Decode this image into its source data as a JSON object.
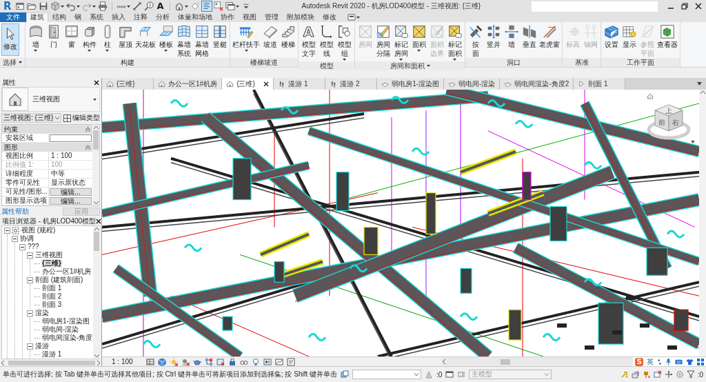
{
  "title_bar": {
    "logo": "R",
    "quick_access": [
      {
        "dropdown": false,
        "active": false
      },
      {
        "dropdown": false,
        "active": false
      },
      {
        "dropdown": false,
        "active": false
      },
      {
        "dropdown": true,
        "active": false
      },
      {
        "dropdown": true,
        "active": false
      },
      {
        "dropdown": true,
        "active": false
      },
      {
        "dropdown": false,
        "active": false
      },
      {
        "dropdown": true,
        "active": false
      },
      {
        "dropdown": false,
        "active": false
      },
      {
        "dropdown": false,
        "active": false
      },
      {
        "glyph": "A",
        "dropdown": false,
        "active": false
      },
      {
        "dropdown": true,
        "active": false
      },
      {
        "dropdown": false,
        "active": false
      },
      {
        "dropdown": false,
        "active": true
      },
      {
        "dropdown": false,
        "active": false
      },
      {
        "dropdown": true,
        "active": false
      },
      {
        "dropdown": false,
        "active": false
      }
    ],
    "title": "Autodesk Revit 2020 - 机房LOD400模型 - 三维视图: {三维}"
  },
  "ribbon_tabs": [
    {
      "label": "文件",
      "kind": "menu",
      "selected": false
    },
    {
      "label": "建筑",
      "kind": "tab",
      "selected": true
    },
    {
      "label": "结构",
      "kind": "tab",
      "selected": false
    },
    {
      "label": "钢",
      "kind": "tab",
      "selected": false
    },
    {
      "label": "系统",
      "kind": "tab",
      "selected": false
    },
    {
      "label": "插入",
      "kind": "tab",
      "selected": false
    },
    {
      "label": "注释",
      "kind": "tab",
      "selected": false
    },
    {
      "label": "分析",
      "kind": "tab",
      "selected": false
    },
    {
      "label": "体量和场地",
      "kind": "tab",
      "selected": false
    },
    {
      "label": "协作",
      "kind": "tab",
      "selected": false
    },
    {
      "label": "视图",
      "kind": "tab",
      "selected": false
    },
    {
      "label": "管理",
      "kind": "tab",
      "selected": false
    },
    {
      "label": "附加模块",
      "kind": "tab",
      "selected": false
    },
    {
      "label": "修改",
      "kind": "tab",
      "selected": false
    }
  ],
  "ribbon": {
    "panels": [
      {
        "title": "选择",
        "menu": true,
        "buttons": [
          {
            "lines": [
              "修改"
            ],
            "dropdown": false,
            "disabled": false,
            "active": true
          }
        ]
      },
      {
        "title": "构建",
        "menu": false,
        "buttons": [
          {
            "lines": [
              "墙"
            ],
            "dropdown": true,
            "disabled": false,
            "active": false
          },
          {
            "lines": [
              "门"
            ],
            "dropdown": false,
            "disabled": false,
            "active": false
          },
          {
            "lines": [
              "窗"
            ],
            "dropdown": false,
            "disabled": false,
            "active": false
          },
          {
            "lines": [
              "构件"
            ],
            "dropdown": true,
            "disabled": false,
            "active": false
          },
          {
            "lines": [
              "柱"
            ],
            "dropdown": true,
            "disabled": false,
            "active": false
          },
          {
            "lines": [
              "屋顶"
            ],
            "dropdown": false,
            "disabled": false,
            "active": false
          },
          {
            "lines": [
              "天花板"
            ],
            "dropdown": false,
            "disabled": false,
            "active": false
          },
          {
            "lines": [
              "楼板"
            ],
            "dropdown": true,
            "disabled": false,
            "active": false
          },
          {
            "lines": [
              "幕墙",
              "系统"
            ],
            "dropdown": false,
            "disabled": false,
            "active": false
          },
          {
            "lines": [
              "幕墙",
              "网格"
            ],
            "dropdown": false,
            "disabled": false,
            "active": false
          },
          {
            "lines": [
              "竖梃"
            ],
            "dropdown": false,
            "disabled": false,
            "active": false
          }
        ]
      },
      {
        "title": "楼梯坡道",
        "menu": false,
        "buttons": [
          {
            "lines": [
              "栏杆扶手"
            ],
            "dropdown": true,
            "disabled": false,
            "active": false
          },
          {
            "lines": [
              "坡道"
            ],
            "dropdown": false,
            "disabled": false,
            "active": false
          },
          {
            "lines": [
              "楼梯"
            ],
            "dropdown": false,
            "disabled": false,
            "active": false
          }
        ]
      },
      {
        "title": "模型",
        "menu": false,
        "buttons": [
          {
            "lines": [
              "模型",
              "文字"
            ],
            "glyph": "A",
            "dropdown": false,
            "disabled": false,
            "active": false
          },
          {
            "lines": [
              "模型",
              "线"
            ],
            "dropdown": false,
            "disabled": false,
            "active": false
          },
          {
            "lines": [
              "模型",
              "组"
            ],
            "dropdown": true,
            "disabled": false,
            "active": false
          }
        ]
      },
      {
        "title": "房间和面积",
        "menu": true,
        "buttons": [
          {
            "lines": [
              "房间"
            ],
            "dropdown": false,
            "disabled": true,
            "active": false
          },
          {
            "lines": [
              "房间",
              "分隔"
            ],
            "dropdown": false,
            "disabled": false,
            "active": false
          },
          {
            "lines": [
              "标记",
              "房间"
            ],
            "dropdown": true,
            "disabled": false,
            "active": false
          },
          {
            "lines": [
              "面积"
            ],
            "dropdown": true,
            "disabled": false,
            "active": false
          },
          {
            "lines": [
              "面积",
              "边界"
            ],
            "dropdown": false,
            "disabled": true,
            "active": false
          },
          {
            "lines": [
              "标记",
              "面积"
            ],
            "dropdown": true,
            "disabled": false,
            "active": false
          }
        ]
      },
      {
        "title": "洞口",
        "menu": false,
        "buttons": [
          {
            "lines": [
              "按",
              "面"
            ],
            "dropdown": false,
            "disabled": false,
            "active": false
          },
          {
            "lines": [
              "竖井"
            ],
            "dropdown": false,
            "disabled": false,
            "active": false
          },
          {
            "lines": [
              "墙"
            ],
            "dropdown": false,
            "disabled": false,
            "active": false
          },
          {
            "lines": [
              "垂直"
            ],
            "dropdown": false,
            "disabled": false,
            "active": false
          },
          {
            "lines": [
              "老虎窗"
            ],
            "dropdown": false,
            "disabled": false,
            "active": false
          }
        ]
      },
      {
        "title": "基准",
        "menu": false,
        "buttons": [
          {
            "lines": [
              "标高"
            ],
            "dropdown": false,
            "disabled": true,
            "active": false
          },
          {
            "lines": [
              "轴网"
            ],
            "dropdown": false,
            "disabled": true,
            "active": false
          }
        ]
      },
      {
        "title": "工作平面",
        "menu": false,
        "buttons": [
          {
            "lines": [
              "设置"
            ],
            "dropdown": false,
            "disabled": false,
            "active": false
          },
          {
            "lines": [
              "显示"
            ],
            "dropdown": false,
            "disabled": false,
            "active": false
          },
          {
            "lines": [
              "参照",
              "平面"
            ],
            "dropdown": false,
            "disabled": true,
            "active": false
          },
          {
            "lines": [
              "查看器"
            ],
            "dropdown": false,
            "disabled": false,
            "active": false
          }
        ]
      }
    ]
  },
  "properties": {
    "title": "属性",
    "type_name": "三维视图",
    "view_selector": "三维视图: {三维}",
    "edit_type": "编辑类型",
    "groups": [
      {
        "name": "约束",
        "expanded": true,
        "rows": [
          {
            "name": "安装区域",
            "kind": "input",
            "disabled": false
          }
        ]
      },
      {
        "name": "图形",
        "expanded": true,
        "rows": [
          {
            "name": "视图比例",
            "kind": "text",
            "value": "1 : 100",
            "disabled": false
          },
          {
            "name": "比例值 1:",
            "kind": "text",
            "value": "100",
            "disabled": true
          },
          {
            "name": "详细程度",
            "kind": "text",
            "value": "中等",
            "disabled": false
          },
          {
            "name": "零件可见性",
            "kind": "text",
            "value": "显示原状态",
            "disabled": false
          },
          {
            "name": "可见性/图形...",
            "kind": "button",
            "value": "编辑...",
            "disabled": false
          },
          {
            "name": "图形显示选项",
            "kind": "button",
            "value": "编辑...",
            "disabled": false
          }
        ]
      }
    ],
    "help_link": "属性帮助",
    "apply": {
      "label": "应用",
      "disabled": true
    }
  },
  "project_browser": {
    "title": "项目浏览器 - 机房LOD400模型",
    "tree": [
      {
        "label": "视图 (规程)",
        "expanded": true,
        "selected": false,
        "children": [
          {
            "label": "协调",
            "expanded": true,
            "selected": false,
            "children": [
              {
                "label": "???",
                "expanded": true,
                "selected": false,
                "children": [
                  {
                    "label": "三维视图",
                    "expanded": true,
                    "selected": false,
                    "children": [
                      {
                        "label": "{三维}",
                        "selected": true
                      },
                      {
                        "label": "办公一区1#机房",
                        "selected": false
                      }
                    ]
                  },
                  {
                    "label": "剖面 (建筑剖面)",
                    "expanded": true,
                    "selected": false,
                    "children": [
                      {
                        "label": "剖面 1",
                        "selected": false
                      },
                      {
                        "label": "剖面 2",
                        "selected": false
                      },
                      {
                        "label": "剖面 3",
                        "selected": false
                      }
                    ]
                  },
                  {
                    "label": "渲染",
                    "expanded": true,
                    "selected": false,
                    "children": [
                      {
                        "label": "弱电房1-渲染图",
                        "selected": false
                      },
                      {
                        "label": "弱电间-渲染",
                        "selected": false
                      },
                      {
                        "label": "弱电间渲染-角度",
                        "selected": false
                      }
                    ]
                  },
                  {
                    "label": "漫游",
                    "expanded": true,
                    "selected": false,
                    "children": [
                      {
                        "label": "漫游 1",
                        "selected": false
                      }
                    ]
                  }
                ]
              }
            ]
          }
        ]
      }
    ]
  },
  "view_tabs": [
    {
      "label": "{三维}",
      "kind": "model",
      "selected": false
    },
    {
      "label": "办公一区1#机房",
      "kind": "model",
      "selected": false
    },
    {
      "label": "{三维}",
      "kind": "model",
      "selected": true
    },
    {
      "label": "漫游 1",
      "kind": "walk",
      "selected": false
    },
    {
      "label": "漫游 2",
      "kind": "walk",
      "selected": false
    },
    {
      "label": "弱电房1-渲染图",
      "kind": "render",
      "selected": false
    },
    {
      "label": "弱电间-渲染",
      "kind": "render",
      "selected": false
    },
    {
      "label": "弱电间渲染-角度2",
      "kind": "render",
      "selected": false
    },
    {
      "label": "剖面 1",
      "kind": "section",
      "selected": false
    }
  ],
  "view_cube": {
    "top": "上",
    "front": "前",
    "right": "右"
  },
  "view_bar": {
    "scale": "1 : 100"
  },
  "status_bar": {
    "hint": "单击可进行选择; 按 Tab 键并单击可选择其他项目; 按 Ctrl 键并单击可将新项目添加到选择集; 按 Shift 键并单击",
    "workset_count": ":0",
    "design_option": {
      "value": "主模型",
      "disabled": true
    },
    "filter_count": ":0"
  },
  "ime_toolbar": {
    "logo": "S",
    "mode": "英"
  }
}
